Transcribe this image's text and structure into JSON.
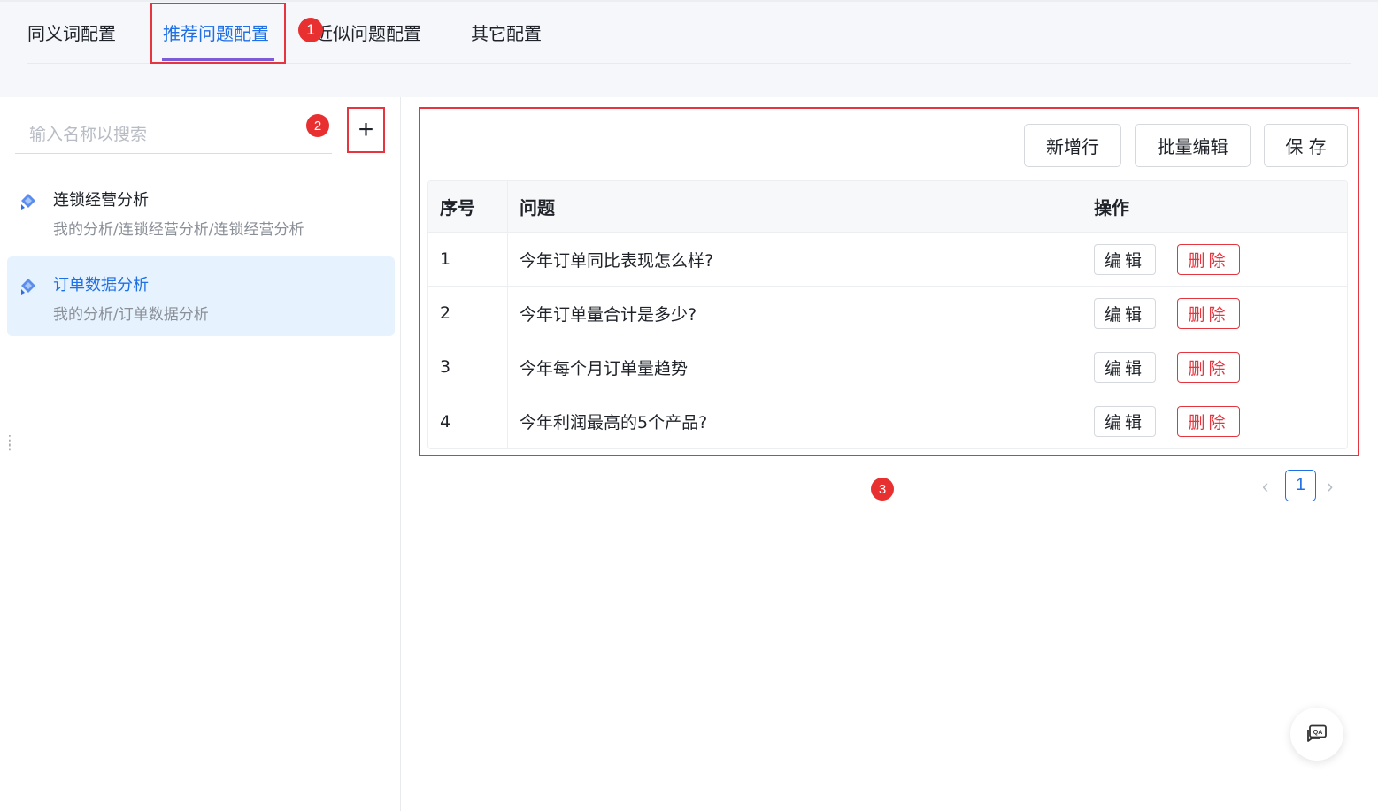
{
  "tabs": [
    {
      "label": "同义词配置"
    },
    {
      "label": "推荐问题配置"
    },
    {
      "label": "近似问题配置"
    },
    {
      "label": "其它配置"
    }
  ],
  "annotations": [
    "1",
    "2",
    "3"
  ],
  "sidebar": {
    "search_placeholder": "输入名称以搜索",
    "add_label": "+",
    "items": [
      {
        "title": "连锁经营分析",
        "path": "我的分析/连锁经营分析/连锁经营分析"
      },
      {
        "title": "订单数据分析",
        "path": "我的分析/订单数据分析"
      }
    ]
  },
  "toolbar": {
    "add_row_label": "新增行",
    "batch_edit_label": "批量编辑",
    "save_label": "保 存"
  },
  "table": {
    "headers": [
      "序号",
      "问题",
      "操作"
    ],
    "rows": [
      {
        "index": "1",
        "question": "今年订单同比表现怎么样?"
      },
      {
        "index": "2",
        "question": "今年订单量合计是多少?"
      },
      {
        "index": "3",
        "question": "今年每个月订单量趋势"
      },
      {
        "index": "4",
        "question": "今年利润最高的5个产品?"
      }
    ],
    "edit_label": "编辑",
    "delete_label": "删除"
  },
  "pagination": {
    "current_page": "1",
    "prev_icon": "‹",
    "next_icon": "›"
  },
  "colors": {
    "accent": "#1f6fe5",
    "annotation": "#e5363f",
    "selected_bg": "#e6f2fd"
  },
  "icons": {
    "list_item_icon": "diamond-chart-icon",
    "fab_icon": "qa-chat-icon"
  }
}
